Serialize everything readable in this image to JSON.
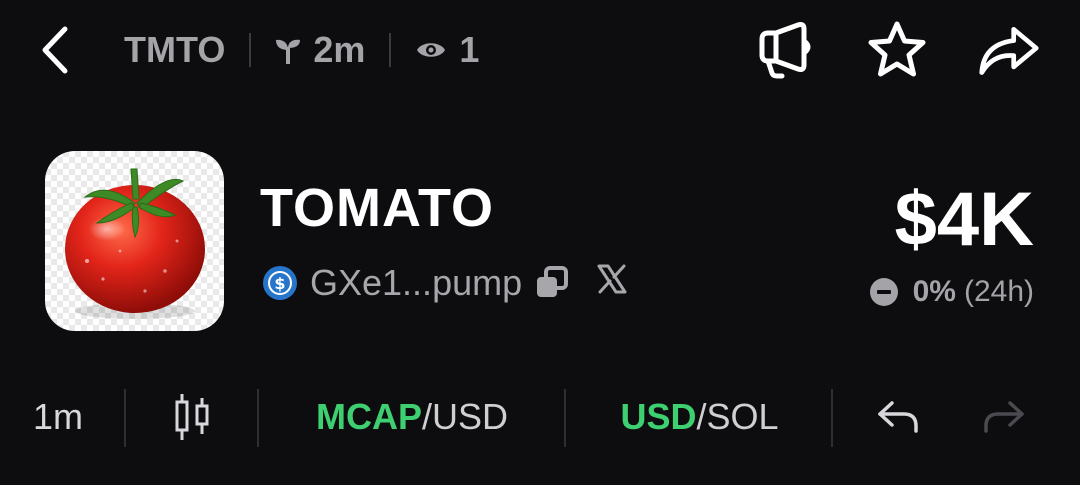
{
  "header": {
    "symbol": "TMTO",
    "age": "2m",
    "viewers": "1"
  },
  "token": {
    "name": "TOMATO",
    "address": "GXe1...pump",
    "x_label": "𝕏",
    "price": "$4K",
    "change": "0%",
    "change_period": "(24h)"
  },
  "toolbar": {
    "interval": "1m",
    "mcap_label": "MCAP",
    "mcap_suffix": "/USD",
    "usd_label": "USD",
    "usd_suffix": "/SOL"
  },
  "colors": {
    "background": "#0d0d10",
    "accent_green": "#3ecf71",
    "muted_text": "#a3a3a8"
  },
  "icons": [
    "back-icon",
    "sprout-icon",
    "eye-icon",
    "megaphone-icon",
    "star-icon",
    "share-icon",
    "usdc-coin-icon",
    "copy-icon",
    "x-icon",
    "minus-circle-icon",
    "candlestick-icon",
    "undo-icon",
    "redo-icon"
  ]
}
